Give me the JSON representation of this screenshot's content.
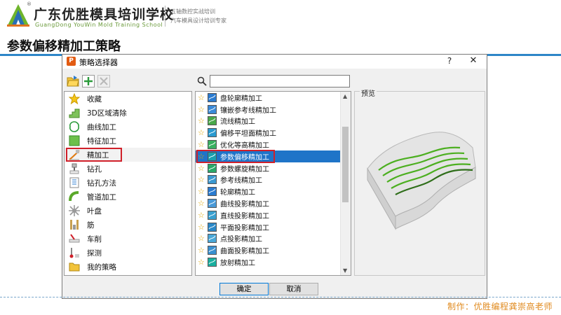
{
  "header": {
    "brand_cn": "广东优胜模具培训学校",
    "brand_en": "GuangDong YouWin Mold Training School",
    "registered": "®",
    "tagline_1": "五轴数控实战培训",
    "tagline_2": "汽车模具设计培训专家"
  },
  "slide_title": "参数偏移精加工策略",
  "footer_credit": "制作：优胜编程龚崇高老师",
  "dialog": {
    "title": "策略选择器",
    "app_icon": "P",
    "help_label": "?",
    "close_label": "✕",
    "search": {
      "value": "",
      "placeholder": ""
    },
    "preview_label": "预览",
    "ok_label": "确定",
    "cancel_label": "取消",
    "categories": [
      {
        "label": "收藏",
        "icon": "star-icon"
      },
      {
        "label": "3D区域清除",
        "icon": "area-clear-icon"
      },
      {
        "label": "曲线加工",
        "icon": "curve-machining-icon"
      },
      {
        "label": "特征加工",
        "icon": "feature-machining-icon"
      },
      {
        "label": "精加工",
        "icon": "finishing-icon",
        "selected": true
      },
      {
        "label": "钻孔",
        "icon": "drilling-icon"
      },
      {
        "label": "钻孔方法",
        "icon": "drilling-method-icon"
      },
      {
        "label": "管道加工",
        "icon": "pipe-machining-icon"
      },
      {
        "label": "叶盘",
        "icon": "blisk-icon"
      },
      {
        "label": "筋",
        "icon": "rib-icon"
      },
      {
        "label": "车削",
        "icon": "turning-icon"
      },
      {
        "label": "探测",
        "icon": "probing-icon"
      },
      {
        "label": "我的策略",
        "icon": "folder-icon"
      }
    ],
    "strategies": [
      {
        "label": "盘轮廓精加工"
      },
      {
        "label": "镶嵌参考线精加工"
      },
      {
        "label": "流线精加工"
      },
      {
        "label": "偏移平坦面精加工"
      },
      {
        "label": "优化等高精加工"
      },
      {
        "label": "参数偏移精加工",
        "selected": true
      },
      {
        "label": "参数螺旋精加工"
      },
      {
        "label": "参考线精加工"
      },
      {
        "label": "轮廓精加工"
      },
      {
        "label": "曲线投影精加工"
      },
      {
        "label": "直线投影精加工"
      },
      {
        "label": "平面投影精加工"
      },
      {
        "label": "点投影精加工"
      },
      {
        "label": "曲面投影精加工"
      },
      {
        "label": "放射精加工"
      }
    ]
  },
  "colors": {
    "title_underline": "#2e86c8",
    "selection_blue": "#1f74c8",
    "highlight_red": "#d0202a",
    "credit_orange": "#e08a1e",
    "preview_curve": "#4caf20"
  }
}
